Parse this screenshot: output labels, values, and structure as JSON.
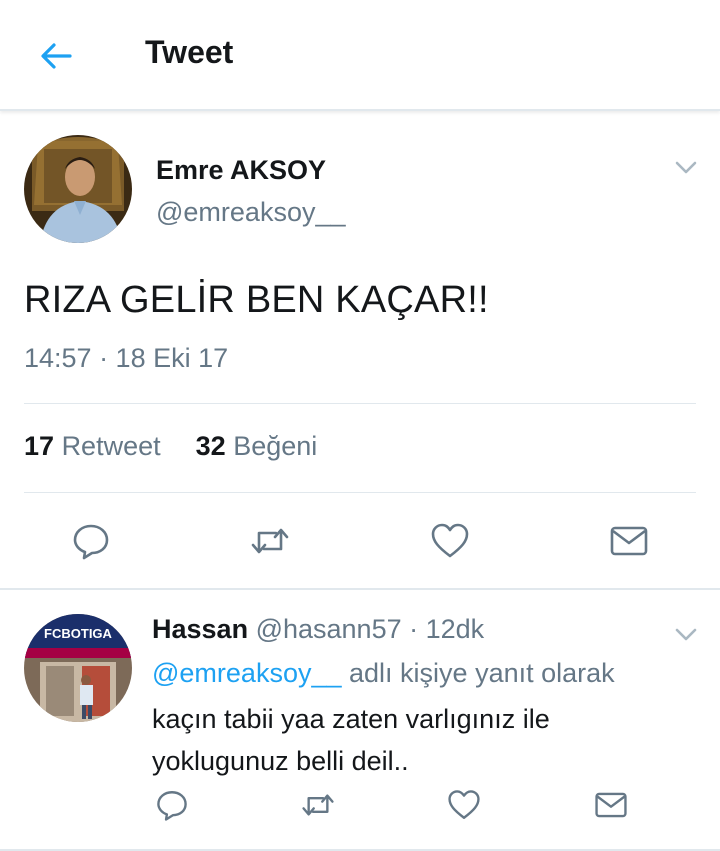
{
  "header": {
    "title": "Tweet",
    "back_icon": "arrow-left-icon"
  },
  "colors": {
    "accent": "#1da1f2",
    "text": "#14171a",
    "secondary": "#657786",
    "divider": "#e1e8ed"
  },
  "tweet": {
    "author_name": "Emre AKSOY",
    "author_handle": "@emreaksoy__",
    "text": "RIZA GELİR BEN KAÇAR!!",
    "timestamp": "14:57 · 18 Eki 17",
    "retweet_count": "17",
    "retweet_label": "Retweet",
    "like_count": "32",
    "like_label": "Beğeni",
    "actions": [
      "reply-icon",
      "retweet-icon",
      "like-icon",
      "message-icon"
    ]
  },
  "reply": {
    "author_name": "Hassan",
    "author_handle": "@hasann57",
    "time_ago": "· 12dk",
    "replying_to_handle": "@emreaksoy__",
    "replying_to_suffix": "adlı kişiye yanıt olarak",
    "text_lines": [
      "kaçın tabii yaa zaten varlıgınız ile",
      "yoklugunuz belli deil.."
    ],
    "avatar_banner_text": "FCBOTIGA",
    "actions": [
      "reply-icon",
      "retweet-icon",
      "like-icon",
      "message-icon"
    ]
  }
}
